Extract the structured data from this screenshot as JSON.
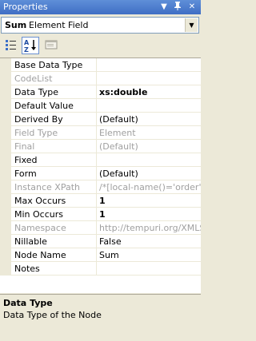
{
  "window": {
    "title": "Properties"
  },
  "selector": {
    "name": "Sum",
    "type": "Element Field"
  },
  "properties": [
    {
      "name": "Base Data Type",
      "value": "",
      "readonly": false,
      "bold": false
    },
    {
      "name": "CodeList",
      "value": "",
      "readonly": true,
      "bold": false
    },
    {
      "name": "Data Type",
      "value": "xs:double",
      "readonly": false,
      "bold": true
    },
    {
      "name": "Default Value",
      "value": "",
      "readonly": false,
      "bold": false
    },
    {
      "name": "Derived By",
      "value": "(Default)",
      "readonly": false,
      "bold": false
    },
    {
      "name": "Field Type",
      "value": "Element",
      "readonly": true,
      "bold": false
    },
    {
      "name": "Final",
      "value": "(Default)",
      "readonly": true,
      "bold": false
    },
    {
      "name": "Fixed",
      "value": "",
      "readonly": false,
      "bold": false
    },
    {
      "name": "Form",
      "value": "(Default)",
      "readonly": false,
      "bold": false
    },
    {
      "name": "Instance XPath",
      "value": "/*[local-name()='order' and",
      "readonly": true,
      "bold": false
    },
    {
      "name": "Max Occurs",
      "value": "1",
      "readonly": false,
      "bold": true
    },
    {
      "name": "Min Occurs",
      "value": "1",
      "readonly": false,
      "bold": true
    },
    {
      "name": "Namespace",
      "value": "http://tempuri.org/XMLSche",
      "readonly": true,
      "bold": false
    },
    {
      "name": "Nillable",
      "value": "False",
      "readonly": false,
      "bold": false
    },
    {
      "name": "Node Name",
      "value": "Sum",
      "readonly": false,
      "bold": false
    },
    {
      "name": "Notes",
      "value": "",
      "readonly": false,
      "bold": false
    }
  ],
  "description": {
    "title": "Data Type",
    "text": "Data Type of the Node"
  }
}
